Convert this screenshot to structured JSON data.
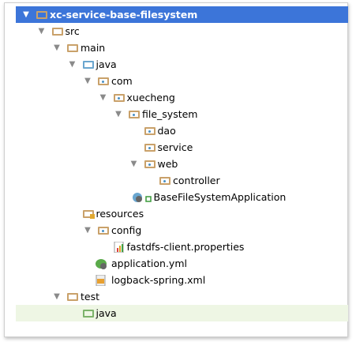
{
  "tree": [
    {
      "label": "xc-service-base-filesystem",
      "level": 0,
      "expanded": true,
      "icon": "module-folder-icon"
    },
    {
      "label": "src",
      "level": 1,
      "expanded": true,
      "icon": "folder-icon"
    },
    {
      "label": "main",
      "level": 2,
      "expanded": true,
      "icon": "folder-icon"
    },
    {
      "label": "java",
      "level": 3,
      "expanded": true,
      "icon": "source-folder-icon"
    },
    {
      "label": "com",
      "level": 4,
      "expanded": true,
      "icon": "package-icon"
    },
    {
      "label": "xuecheng",
      "level": 5,
      "expanded": true,
      "icon": "package-icon"
    },
    {
      "label": "file_system",
      "level": 6,
      "expanded": true,
      "icon": "package-icon"
    },
    {
      "label": "dao",
      "level": 7,
      "icon": "package-icon"
    },
    {
      "label": "service",
      "level": 7,
      "icon": "package-icon"
    },
    {
      "label": "web",
      "level": 7,
      "expanded": true,
      "icon": "package-icon"
    },
    {
      "label": "controller",
      "level": 8,
      "icon": "package-icon"
    },
    {
      "label": "BaseFileSystemApplication",
      "level": 7,
      "icon": "spring-boot-class-icon"
    },
    {
      "label": "resources",
      "level": 3,
      "icon": "resources-folder-icon"
    },
    {
      "label": "config",
      "level": 4,
      "expanded": true,
      "icon": "package-icon"
    },
    {
      "label": "fastdfs-client.properties",
      "level": 5,
      "icon": "properties-file-icon"
    },
    {
      "label": "application.yml",
      "level": 4,
      "icon": "spring-yml-icon"
    },
    {
      "label": "logback-spring.xml",
      "level": 4,
      "icon": "xml-file-icon"
    },
    {
      "label": "test",
      "level": 2,
      "expanded": true,
      "icon": "folder-icon"
    },
    {
      "label": "java",
      "level": 3,
      "icon": "test-folder-icon"
    }
  ]
}
